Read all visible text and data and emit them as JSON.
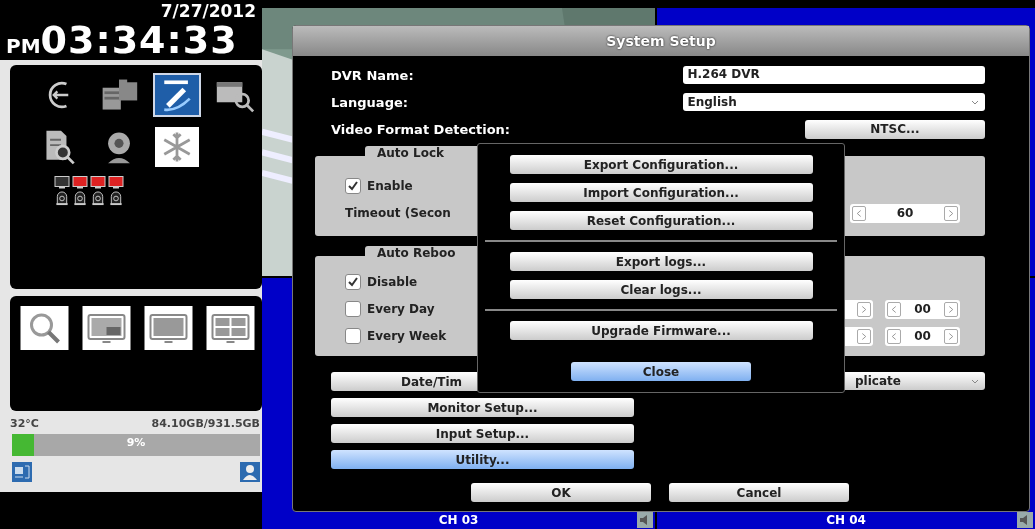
{
  "clock": {
    "date": "7/27/2012",
    "meridiem": "PM",
    "time": "03:34:33"
  },
  "menu_icons": [
    {
      "kind": "rewind",
      "selected": false,
      "on": false
    },
    {
      "kind": "folders",
      "selected": false,
      "on": false
    },
    {
      "kind": "tools",
      "selected": true,
      "on": false
    },
    {
      "kind": "calendar-search",
      "selected": false,
      "on": false
    },
    {
      "kind": "document-search",
      "selected": false,
      "on": false
    },
    {
      "kind": "webcam",
      "selected": false,
      "on": false
    },
    {
      "kind": "snowflake",
      "selected": false,
      "on": true
    }
  ],
  "channel_status": [
    {
      "alarm": false
    },
    {
      "alarm": true
    },
    {
      "alarm": true
    },
    {
      "alarm": true
    }
  ],
  "view_buttons": [
    {
      "kind": "search"
    },
    {
      "kind": "pip"
    },
    {
      "kind": "single"
    },
    {
      "kind": "quad"
    }
  ],
  "storage": {
    "temperature": "32°C",
    "usage": "84.10GB/931.5GB",
    "level": 0.09,
    "percent": "9%"
  },
  "tiles": [
    {
      "kind": "picture"
    },
    {
      "kind": "blank"
    },
    {
      "kind": "blank",
      "label": "CH 03"
    },
    {
      "kind": "blank",
      "label": "CH 04"
    }
  ],
  "dialog": {
    "title": "System Setup",
    "fields": [
      {
        "label": "DVR Name:",
        "kind": "text",
        "value": "H.264 DVR"
      },
      {
        "label": "Language:",
        "kind": "select",
        "value": "English"
      },
      {
        "label": "Video Format Detection:",
        "kind": "button",
        "value": "NTSC..."
      }
    ],
    "auto_lock": {
      "title": "Auto Lock",
      "enable": {
        "label": "Enable",
        "checked": true
      },
      "timeout_label": "Timeout (Secon",
      "timeout": "60"
    },
    "auto_reboot": {
      "title": "Auto Reboo",
      "options": [
        {
          "label": "Disable",
          "checked": true
        },
        {
          "label": "Every Day",
          "checked": false,
          "minute": "00"
        },
        {
          "label": "Every Week",
          "checked": false,
          "minute": "00"
        }
      ]
    },
    "buttons": [
      {
        "label": "Date/Tim",
        "selected": false
      },
      {
        "label": "Monitor Setup...",
        "selected": false
      },
      {
        "label": "Input Setup...",
        "selected": false
      },
      {
        "label": "Utility...",
        "selected": true
      }
    ],
    "duplicate_select": "plicate",
    "actions": [
      "OK",
      "Cancel"
    ]
  },
  "utility_menu": {
    "groups": [
      [
        "Export Configuration...",
        "Import Configuration...",
        "Reset Configuration..."
      ],
      [
        "Export logs...",
        "Clear logs..."
      ],
      [
        "Upgrade Firmware..."
      ]
    ],
    "close": "Close"
  }
}
